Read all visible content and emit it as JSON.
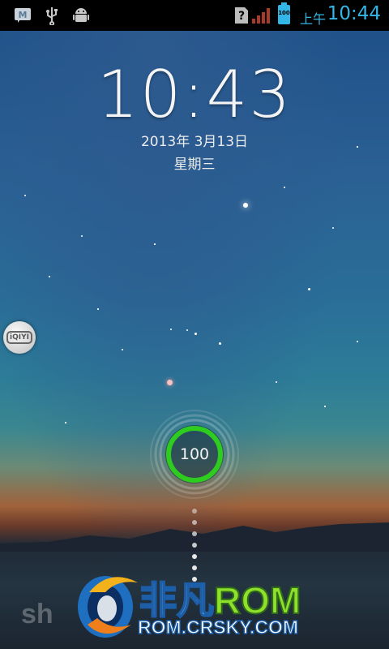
{
  "status_bar": {
    "ampm": "上午",
    "time": "10:44",
    "battery_level": "100",
    "icons": [
      "messaging-icon",
      "usb-icon",
      "android-debug-icon",
      "no-sim-icon",
      "signal-icon",
      "battery-icon"
    ]
  },
  "lockscreen": {
    "clock": "10:43",
    "date": "2013年 3月13日",
    "weekday": "星期三",
    "side_app_label": "iQIYI",
    "unlock_ring_value": "100",
    "ring_color": "#2ecc1f"
  },
  "watermark": {
    "title_cn": "非凡",
    "title_rom": "ROM",
    "url": "ROM.CRSKY.COM",
    "shell_text": "sh"
  }
}
